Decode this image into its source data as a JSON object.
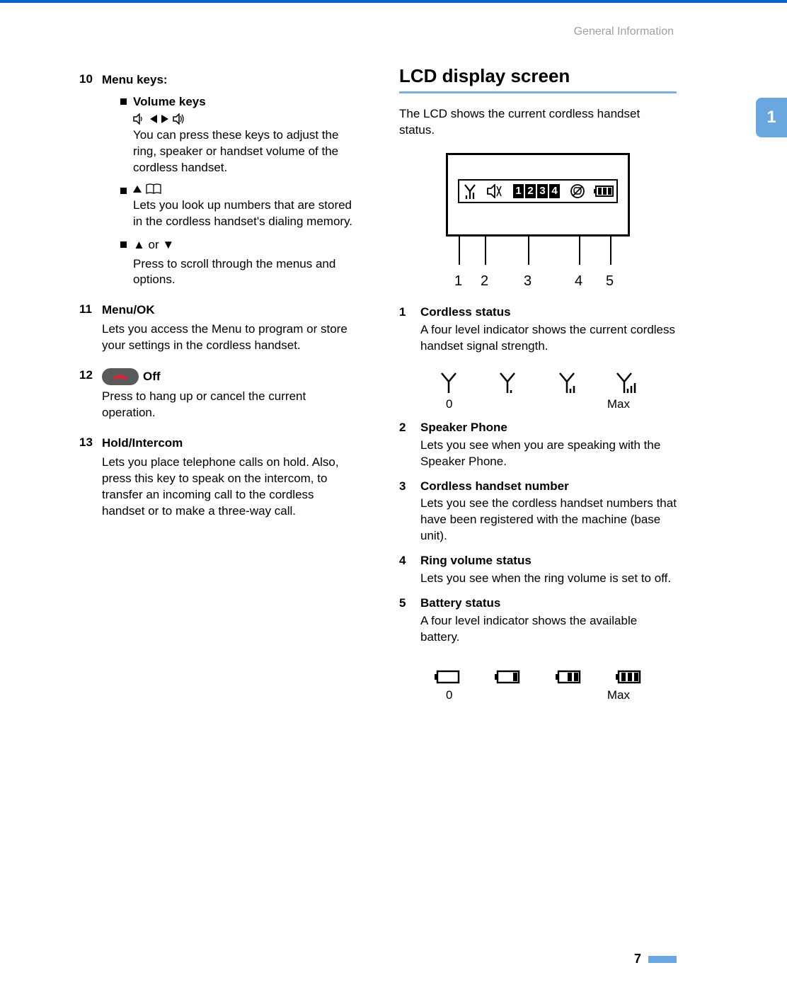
{
  "header": "General Information",
  "chapter_tab": "1",
  "page_number": "7",
  "left": {
    "items": [
      {
        "num": "10",
        "title": "Menu keys:",
        "bullets": [
          {
            "title": "Volume keys",
            "desc": "You can press these keys to adjust the ring, speaker or handset volume of the cordless handset."
          },
          {
            "title_icons": "up_book",
            "desc": "Lets you look up numbers that are stored in the cordless handset's dialing memory."
          },
          {
            "title": "▲ or ▼",
            "desc": "Press to scroll through the menus and options."
          }
        ]
      },
      {
        "num": "11",
        "title": "Menu/OK",
        "desc": "Lets you access the Menu to program or store your settings in the cordless handset."
      },
      {
        "num": "12",
        "title": "Off",
        "has_off_button": true,
        "desc": "Press to hang up or cancel the current operation."
      },
      {
        "num": "13",
        "title": "Hold/Intercom",
        "desc": "Lets you place telephone calls on hold. Also, press this key to speak on the intercom, to transfer an incoming call to the cordless handset or to make a three-way call."
      }
    ]
  },
  "right": {
    "section_title": "LCD display screen",
    "intro": "The LCD shows the current cordless handset status.",
    "lcd_numbers": [
      "1",
      "2",
      "3",
      "4"
    ],
    "callouts": [
      "1",
      "2",
      "3",
      "4",
      "5"
    ],
    "descriptions": [
      {
        "n": "1",
        "h": "Cordless status",
        "d": "A four level indicator shows the current cordless handset signal strength."
      },
      {
        "n": "2",
        "h": "Speaker Phone",
        "d": "Lets you see when you are speaking with the Speaker Phone."
      },
      {
        "n": "3",
        "h": "Cordless handset number",
        "d": "Lets you see the cordless handset numbers that have been registered with the machine (base unit)."
      },
      {
        "n": "4",
        "h": "Ring volume status",
        "d": "Lets you see when the ring volume is set to off."
      },
      {
        "n": "5",
        "h": "Battery status",
        "d": "A four level indicator shows the available battery."
      }
    ],
    "signal_labels": {
      "min": "0",
      "max": "Max"
    },
    "battery_labels": {
      "min": "0",
      "max": "Max"
    }
  }
}
